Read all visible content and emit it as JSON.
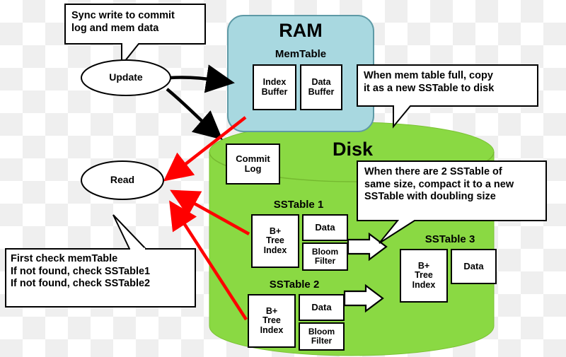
{
  "diagram": {
    "title_ram": "RAM",
    "title_disk": "Disk",
    "memtable_label": "MemTable",
    "nodes": {
      "update": "Update",
      "read": "Read",
      "index_buffer": "Index\nBuffer",
      "data_buffer": "Data\nBuffer",
      "commit_log": "Commit\nLog",
      "sstable1_label": "SSTable 1",
      "sstable2_label": "SSTable 2",
      "sstable3_label": "SSTable 3",
      "bptree_index_1": "B+\nTree\nIndex",
      "bptree_index_2": "B+\nTree\nIndex",
      "bptree_index_3": "B+\nTree\nIndex",
      "data_1": "Data",
      "data_2": "Data",
      "data_3": "Data",
      "bloom_filter_1": "Bloom\nFilter",
      "bloom_filter_2": "Bloom\nFilter"
    },
    "callouts": {
      "sync_write": "Sync write to commit\nlog and mem data",
      "memtable_full": "When mem table full, copy\nit as a new SSTable to disk",
      "compaction": "When there are 2 SSTable of\nsame size, compact it to a new\nSSTable with doubling size",
      "read_path": "First check memTable\nIf not found, check SSTable1\nIf not found, check SSTable2"
    },
    "colors": {
      "ram_fill": "#a8d8e0",
      "disk_fill": "#7ed321",
      "disk_fill_exact": "#8ad943",
      "box_fill": "#ffffff",
      "stroke": "#000000",
      "arrow_black": "#000000",
      "arrow_red": "#ff0000",
      "arrow_white": "#ffffff"
    }
  }
}
